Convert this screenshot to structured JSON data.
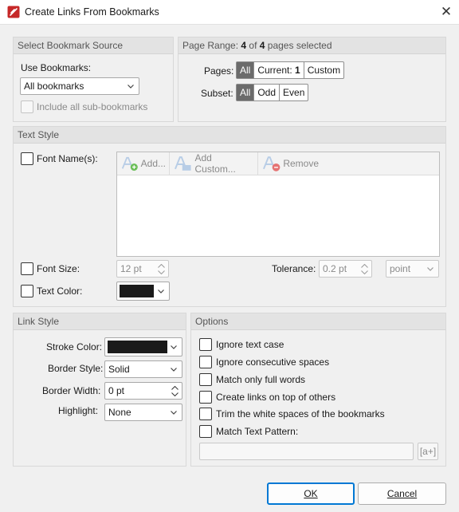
{
  "window": {
    "title": "Create Links From Bookmarks",
    "close_glyph": "✕"
  },
  "source": {
    "header": "Select Bookmark Source",
    "use_label": "Use Bookmarks:",
    "use_value": "All bookmarks",
    "include_sub": "Include all sub-bookmarks"
  },
  "range": {
    "header_prefix": "Page Range: ",
    "count": "4",
    "of": " of ",
    "total": "4",
    "suffix": " pages selected",
    "pages_label": "Pages:",
    "pages_all": "All",
    "pages_current": "Current:",
    "pages_current_num": "1",
    "pages_custom": "Custom",
    "subset_label": "Subset:",
    "subset_all": "All",
    "subset_odd": "Odd",
    "subset_even": "Even"
  },
  "text_style": {
    "header": "Text Style",
    "font_names": "Font Name(s):",
    "add": "Add...",
    "add_custom": "Add Custom...",
    "remove": "Remove",
    "font_size_label": "Font Size:",
    "font_size_value": "12 pt",
    "tolerance_label": "Tolerance:",
    "tolerance_value": "0.2 pt",
    "tolerance_unit": "point",
    "text_color_label": "Text Color:"
  },
  "link_style": {
    "header": "Link Style",
    "stroke_color_label": "Stroke Color:",
    "border_style_label": "Border Style:",
    "border_style_value": "Solid",
    "border_width_label": "Border Width:",
    "border_width_value": "0 pt",
    "highlight_label": "Highlight:",
    "highlight_value": "None"
  },
  "options": {
    "header": "Options",
    "items": [
      "Ignore text case",
      "Ignore consecutive spaces",
      "Match only full words",
      "Create links on top of others",
      "Trim the white spaces of the bookmarks",
      "Match Text Pattern:"
    ],
    "pattern_button": "[a+]"
  },
  "buttons": {
    "ok": "OK",
    "cancel": "Cancel"
  },
  "colors": {
    "accent": "#0078d4",
    "swatch": "#1a1a1a",
    "app_icon": "#c62828"
  }
}
